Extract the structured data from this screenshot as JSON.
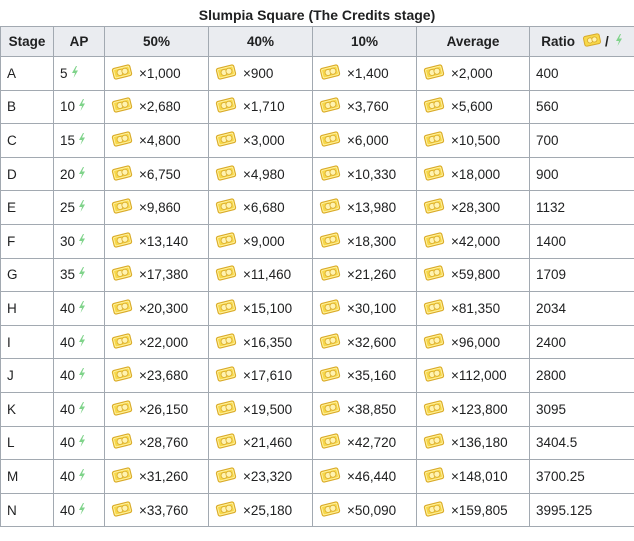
{
  "caption": "Slumpia Square (The Credits stage)",
  "headers": {
    "stage": "Stage",
    "ap": "AP",
    "p50": "50%",
    "p40": "40%",
    "p10": "10%",
    "avg": "Average",
    "ratio": "Ratio",
    "ratio_sep": "/"
  },
  "icons": {
    "credit": "credit-card-icon",
    "ap": "lightning-bolt-icon"
  },
  "colors": {
    "header_bg": "#eaecf0",
    "border": "#a2a9b1",
    "bolt": "#7fd38a",
    "coin": "#f7d84a"
  },
  "rows": [
    {
      "stage": "A",
      "ap": "5",
      "p50": "×1,000",
      "p40": "×900",
      "p10": "×1,400",
      "avg": "×2,000",
      "ratio": "400"
    },
    {
      "stage": "B",
      "ap": "10",
      "p50": "×2,680",
      "p40": "×1,710",
      "p10": "×3,760",
      "avg": "×5,600",
      "ratio": "560"
    },
    {
      "stage": "C",
      "ap": "15",
      "p50": "×4,800",
      "p40": "×3,000",
      "p10": "×6,000",
      "avg": "×10,500",
      "ratio": "700"
    },
    {
      "stage": "D",
      "ap": "20",
      "p50": "×6,750",
      "p40": "×4,980",
      "p10": "×10,330",
      "avg": "×18,000",
      "ratio": "900"
    },
    {
      "stage": "E",
      "ap": "25",
      "p50": "×9,860",
      "p40": "×6,680",
      "p10": "×13,980",
      "avg": "×28,300",
      "ratio": "1132"
    },
    {
      "stage": "F",
      "ap": "30",
      "p50": "×13,140",
      "p40": "×9,000",
      "p10": "×18,300",
      "avg": "×42,000",
      "ratio": "1400"
    },
    {
      "stage": "G",
      "ap": "35",
      "p50": "×17,380",
      "p40": "×11,460",
      "p10": "×21,260",
      "avg": "×59,800",
      "ratio": "1709"
    },
    {
      "stage": "H",
      "ap": "40",
      "p50": "×20,300",
      "p40": "×15,100",
      "p10": "×30,100",
      "avg": "×81,350",
      "ratio": "2034"
    },
    {
      "stage": "I",
      "ap": "40",
      "p50": "×22,000",
      "p40": "×16,350",
      "p10": "×32,600",
      "avg": "×96,000",
      "ratio": "2400"
    },
    {
      "stage": "J",
      "ap": "40",
      "p50": "×23,680",
      "p40": "×17,610",
      "p10": "×35,160",
      "avg": "×112,000",
      "ratio": "2800"
    },
    {
      "stage": "K",
      "ap": "40",
      "p50": "×26,150",
      "p40": "×19,500",
      "p10": "×38,850",
      "avg": "×123,800",
      "ratio": "3095"
    },
    {
      "stage": "L",
      "ap": "40",
      "p50": "×28,760",
      "p40": "×21,460",
      "p10": "×42,720",
      "avg": "×136,180",
      "ratio": "3404.5"
    },
    {
      "stage": "M",
      "ap": "40",
      "p50": "×31,260",
      "p40": "×23,320",
      "p10": "×46,440",
      "avg": "×148,010",
      "ratio": "3700.25"
    },
    {
      "stage": "N",
      "ap": "40",
      "p50": "×33,760",
      "p40": "×25,180",
      "p10": "×50,090",
      "avg": "×159,805",
      "ratio": "3995.125"
    }
  ]
}
